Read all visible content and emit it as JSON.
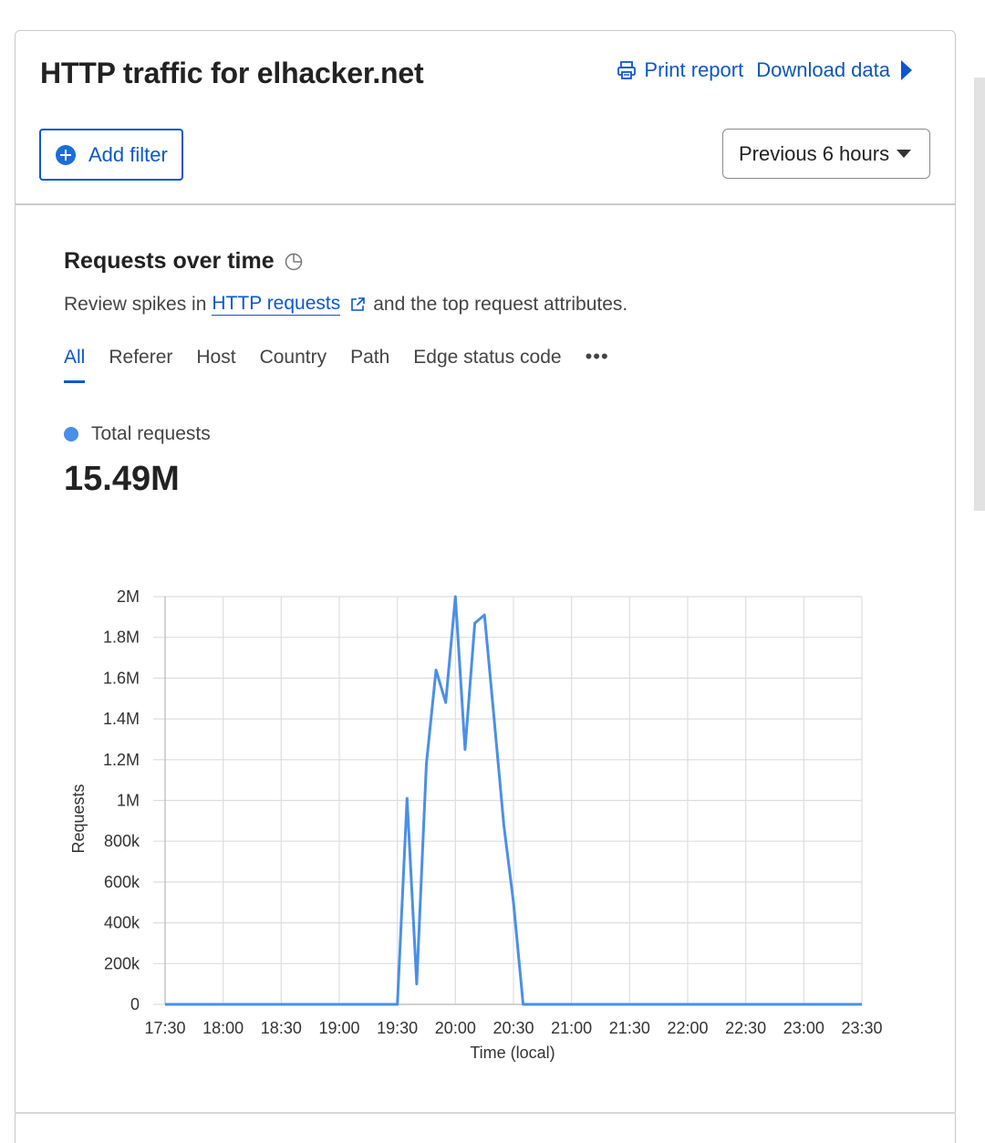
{
  "header": {
    "title": "HTTP traffic for elhacker.net",
    "print_label": "Print report",
    "download_label": "Download data"
  },
  "filters": {
    "add_filter_label": "Add filter",
    "time_range": "Previous 6 hours"
  },
  "section": {
    "title": "Requests over time",
    "desc_prefix": "Review spikes in",
    "desc_link": "HTTP requests",
    "desc_suffix": "and the top request attributes."
  },
  "tabs": [
    "All",
    "Referer",
    "Host",
    "Country",
    "Path",
    "Edge status code"
  ],
  "more_label": "•••",
  "legend": {
    "label": "Total requests",
    "total": "15.49M",
    "color": "#4a8fe8"
  },
  "chart_data": {
    "type": "line",
    "xlabel": "Time (local)",
    "ylabel": "Requests",
    "ylim": [
      0,
      2000000
    ],
    "y_ticks": [
      0,
      200000,
      400000,
      600000,
      800000,
      1000000,
      1200000,
      1400000,
      1600000,
      1800000,
      2000000
    ],
    "y_tick_labels": [
      "0",
      "200k",
      "400k",
      "600k",
      "800k",
      "1M",
      "1.2M",
      "1.4M",
      "1.6M",
      "1.8M",
      "2M"
    ],
    "x_tick_labels": [
      "17:30",
      "18:00",
      "18:30",
      "19:00",
      "19:30",
      "20:00",
      "20:30",
      "21:00",
      "21:30",
      "22:00",
      "22:30",
      "23:00",
      "23:30"
    ],
    "x_minutes": [
      0,
      30,
      60,
      90,
      120,
      125,
      130,
      135,
      140,
      145,
      150,
      155,
      160,
      165,
      170,
      175,
      180,
      185,
      190,
      195,
      240,
      270,
      300,
      330,
      360
    ],
    "x": [
      "17:30",
      "18:00",
      "18:30",
      "19:00",
      "19:30",
      "19:35",
      "19:40",
      "19:45",
      "19:50",
      "19:55",
      "20:00",
      "20:05",
      "20:10",
      "20:15",
      "20:20",
      "20:25",
      "20:30",
      "20:35",
      "20:40",
      "20:45",
      "21:30",
      "22:00",
      "22:30",
      "23:00",
      "23:30"
    ],
    "series": [
      {
        "name": "Total requests",
        "color": "#4a8fe8",
        "values": [
          0,
          0,
          0,
          0,
          0,
          1010000,
          100000,
          1180000,
          1640000,
          1480000,
          2000000,
          1250000,
          1870000,
          1910000,
          1400000,
          880000,
          500000,
          0,
          0,
          0,
          0,
          0,
          0,
          0,
          0
        ]
      }
    ]
  }
}
